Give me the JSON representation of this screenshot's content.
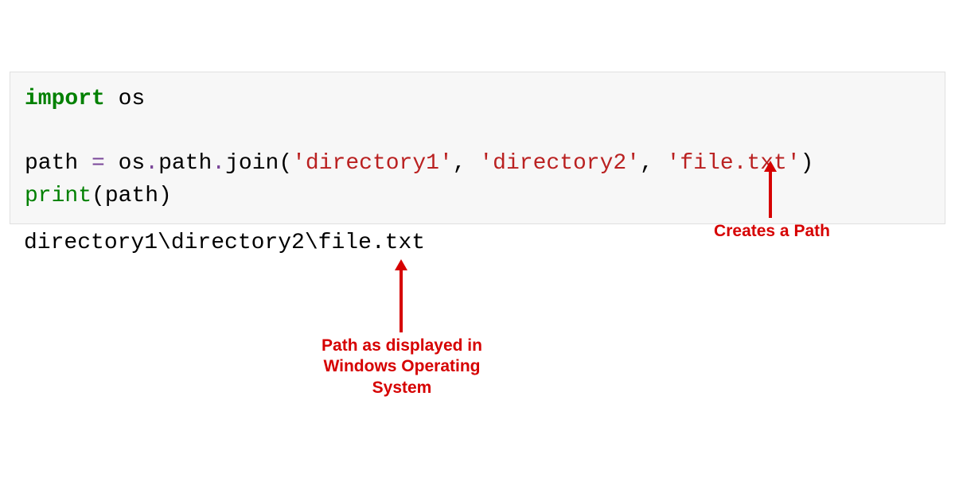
{
  "code": {
    "line1": {
      "import_kw": "import",
      "module": " os"
    },
    "line3": {
      "var": "path ",
      "eq": "=",
      "expr_prefix": " os",
      "dot1": ".",
      "path_attr": "path",
      "dot2": ".",
      "join_fn": "join",
      "paren_open": "(",
      "arg1": "'directory1'",
      "comma1": ", ",
      "arg2": "'directory2'",
      "comma2": ", ",
      "arg3": "'file.txt'",
      "paren_close": ")"
    },
    "line4": {
      "print_fn": "print",
      "paren_open": "(",
      "arg": "path",
      "paren_close": ")"
    }
  },
  "output": "directory1\\directory2\\file.txt",
  "annotations": {
    "creates_path": "Creates a Path",
    "windows_path_l1": "Path as displayed in",
    "windows_path_l2": "Windows Operating",
    "windows_path_l3": "System"
  }
}
